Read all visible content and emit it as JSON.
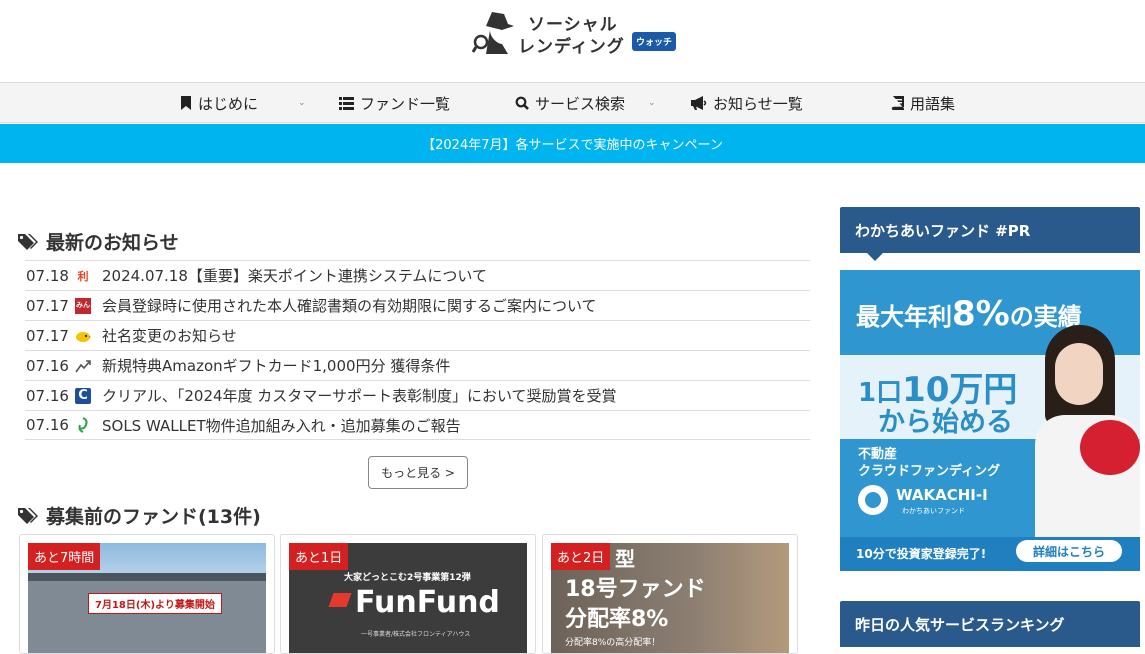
{
  "site": {
    "logo_line1": "ソーシャル",
    "logo_line2": "レンディング",
    "logo_badge": "ウォッチ"
  },
  "nav": {
    "items": [
      {
        "label": "はじめに",
        "icon": "bookmark-icon",
        "has_dropdown": true
      },
      {
        "label": "ファンド一覧",
        "icon": "list-icon",
        "has_dropdown": false
      },
      {
        "label": "サービス検索",
        "icon": "search-icon",
        "has_dropdown": true
      },
      {
        "label": "お知らせ一覧",
        "icon": "megaphone-icon",
        "has_dropdown": false
      },
      {
        "label": "用語集",
        "icon": "book-icon",
        "has_dropdown": false
      }
    ]
  },
  "banner": {
    "text": "【2024年7月】各サービスで実施中のキャンペーン"
  },
  "news": {
    "title": "最新のお知らせ",
    "items": [
      {
        "date": "07.18",
        "icon": "rimawari-logo-icon",
        "text": "2024.07.18【重要】楽天ポイント連携システムについて"
      },
      {
        "date": "07.17",
        "icon": "minna-fund-logo-icon",
        "text": "会員登録時に使用された本人確認書類の有効期限に関するご案内について"
      },
      {
        "date": "07.17",
        "icon": "bird-logo-icon",
        "text": "社名変更のお知らせ"
      },
      {
        "date": "07.16",
        "icon": "arrow-logo-icon",
        "text": "新規特典Amazonギフトカード1,000円分 獲得条件"
      },
      {
        "date": "07.16",
        "icon": "crial-logo-icon",
        "text": "クリアル、「2024年度 カスタマーサポート表彰制度」において奨励賞を受賞"
      },
      {
        "date": "07.16",
        "icon": "sols-logo-icon",
        "text": "SOLS WALLET物件追加組み入れ・追加募集のご報告"
      }
    ],
    "more_label": "もっと見る >"
  },
  "funds": {
    "title": "募集前のファンド(13件)",
    "cards": [
      {
        "badge": "あと7時間",
        "overlay": "7月18日(木)より募集開始"
      },
      {
        "badge": "あと1日",
        "overlay_top": "大家どっとこむ2号事業第12弾",
        "overlay_brand": "FunFund",
        "overlay_bottom": "一号事業者/株式会社フロンティアハウス"
      },
      {
        "badge": "あと2日",
        "overlay_line0": "型",
        "overlay_line1": "18号ファンド",
        "overlay_line2": "分配率8%",
        "overlay_line3": "分配率8%の高分配率！"
      }
    ]
  },
  "sidebar": {
    "pr_title": "わかちあいファンド #PR",
    "ad": {
      "headline_pre": "最大年利",
      "headline_num": "8%",
      "headline_post": "の実績",
      "line2a": "1口",
      "line2b": "10万円",
      "line3": "から始める",
      "sub1": "不動産",
      "sub2": "クラウドファンディング",
      "brand": "WAKACHI-I",
      "brand_sub": "わかちあいファンド",
      "footer": "10分で投資家登録完了!",
      "cta": "詳細はこちら"
    },
    "ranking_title": "昨日の人気サービスランキング"
  },
  "colors": {
    "banner": "#00b4f0",
    "side_header": "#2a5a8c",
    "badge_red": "#d42020"
  }
}
